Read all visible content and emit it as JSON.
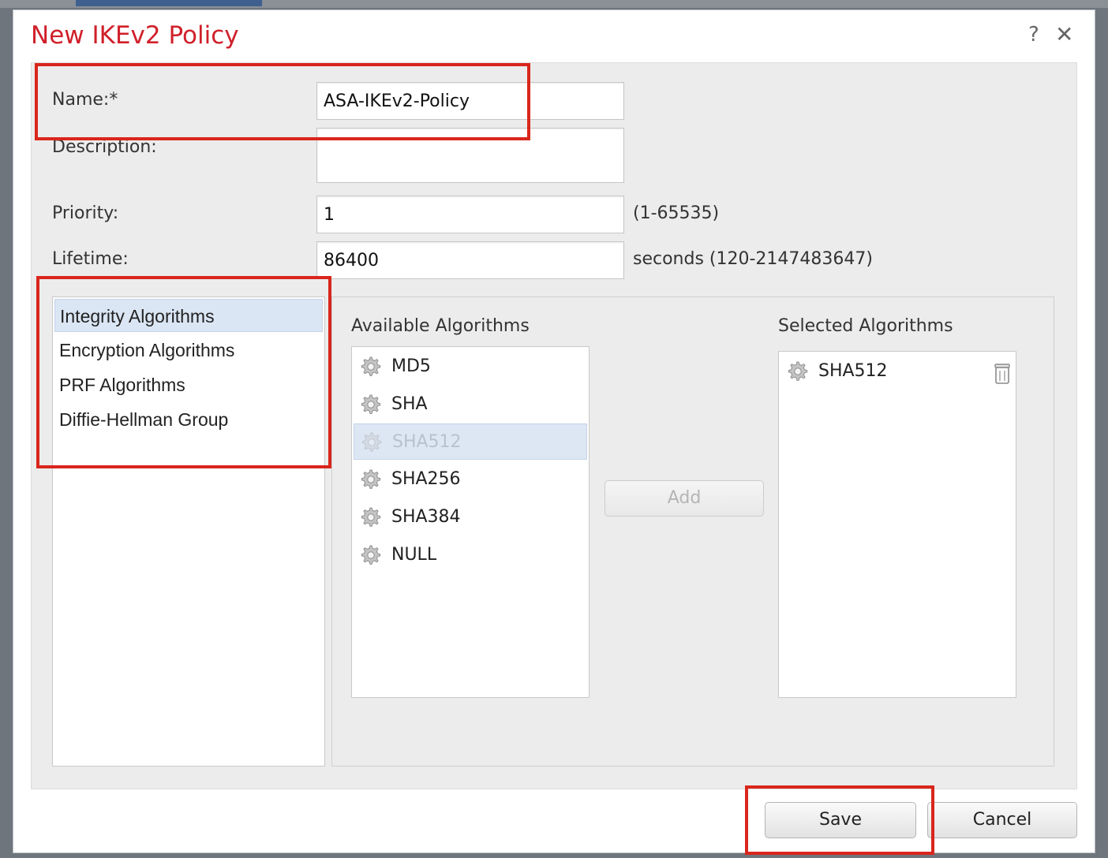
{
  "dialog": {
    "title": "New IKEv2 Policy",
    "help_label": "?",
    "close_label": "✕"
  },
  "form": {
    "name_label": "Name:*",
    "name_value": "ASA-IKEv2-Policy",
    "description_label": "Description:",
    "description_value": "",
    "priority_label": "Priority:",
    "priority_value": "1",
    "priority_hint": "(1-65535)",
    "lifetime_label": "Lifetime:",
    "lifetime_value": "86400",
    "lifetime_hint": "seconds (120-2147483647)"
  },
  "categories": {
    "selected": "Integrity Algorithms",
    "items": [
      {
        "label": "Integrity Algorithms"
      },
      {
        "label": "Encryption Algorithms"
      },
      {
        "label": "PRF Algorithms"
      },
      {
        "label": "Diffie-Hellman Group"
      }
    ]
  },
  "available": {
    "title": "Available Algorithms",
    "selected": "SHA512",
    "items": [
      {
        "label": "MD5"
      },
      {
        "label": "SHA"
      },
      {
        "label": "SHA512"
      },
      {
        "label": "SHA256"
      },
      {
        "label": "SHA384"
      },
      {
        "label": "NULL"
      }
    ]
  },
  "add_button": {
    "label": "Add",
    "enabled": false
  },
  "selected_algorithms": {
    "title": "Selected Algorithms",
    "items": [
      {
        "label": "SHA512"
      }
    ]
  },
  "footer": {
    "save_label": "Save",
    "cancel_label": "Cancel"
  },
  "colors": {
    "title_red": "#d0202a",
    "highlight_red": "#d9261c",
    "selection_blue": "#dbe6f4"
  },
  "icons": {
    "algorithm": "gear-icon",
    "remove": "trash-icon"
  }
}
